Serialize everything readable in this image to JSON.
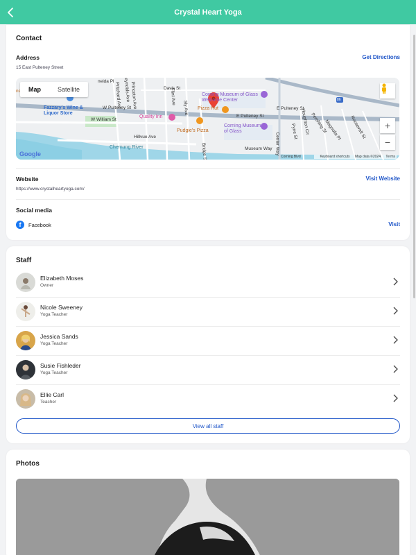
{
  "header": {
    "title": "Crystal Heart Yoga",
    "back_icon": "chevron-left-icon"
  },
  "contact": {
    "title": "Contact",
    "address_label": "Address",
    "address_value": "15 East Pulteney Street",
    "directions_label": "Get Directions",
    "map": {
      "type_map": "Map",
      "type_satellite": "Satellite",
      "zoom_in": "+",
      "zoom_out": "−",
      "google": "Google",
      "attribution": [
        "Keyboard shortcuts",
        "Map data ©2024",
        "Terms"
      ],
      "labels": {
        "fazzary": "Fazzary's Wine & Liquor Store",
        "corning_museum_welcome": "Corning Museum of Glass Welcome Center",
        "corning_museum": "Corning Museum of Glass",
        "pizza_hut": "Pizza Hut",
        "pudgies": "Pudgie's Pizza",
        "quality_inn": "Quality Inn",
        "w_pulteney": "W Pulteney St",
        "e_pulteney": "E Pulteney St",
        "e_pulteney2": "E Pulteney St",
        "w_william": "W William St",
        "hillvue": "Hillvue Ave",
        "chemung": "Chemung River",
        "museum_way": "Museum Way",
        "davis": "Davis St",
        "princeton": "Princeton Ave",
        "flint": "Flint Ave",
        "sly": "Sly Ave",
        "pritchard": "Pritchard Ave",
        "reynolds": "Reynolds Ave",
        "center": "Center Way",
        "corning_blvd": "Corning Blvd",
        "pyne": "Pyne St",
        "houghton": "Houghton Cir",
        "pershing": "Pershing St",
        "roosevelt": "Roosevelt St",
        "magnolia": "Magnolia Pl",
        "bridge": "Bridge St",
        "hwy": "86",
        "meida": "neida Pl",
        "ins": "ns"
      }
    },
    "website_label": "Website",
    "website_value": "https://www.crystalheartyoga.com/",
    "visit_website_label": "Visit Website",
    "social_label": "Social media",
    "facebook_label": "Facebook",
    "facebook_icon": "f",
    "visit_label": "Visit"
  },
  "staff": {
    "title": "Staff",
    "members": [
      {
        "name": "Elizabeth Moses",
        "role": "Owner"
      },
      {
        "name": "Nicole Sweeney",
        "role": "Yoga Teacher"
      },
      {
        "name": "Jessica Sands",
        "role": "Yoga Teacher"
      },
      {
        "name": "Susie Fishleder",
        "role": "Yoga Teacher"
      },
      {
        "name": "Ellie Carl",
        "role": "Teacher"
      }
    ],
    "view_all_label": "View all staff"
  },
  "photos": {
    "title": "Photos"
  },
  "colors": {
    "accent": "#40c9a2",
    "link": "#1e55c8",
    "facebook": "#1877f2"
  }
}
